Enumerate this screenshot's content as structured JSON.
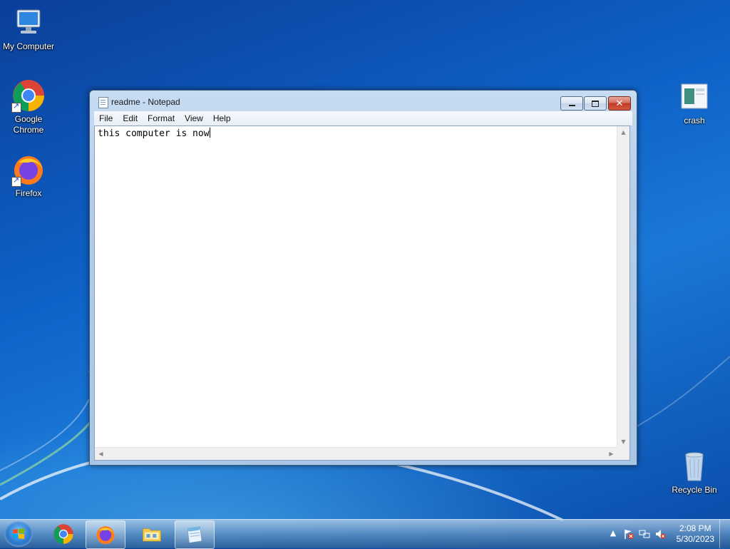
{
  "desktop": {
    "icons": [
      {
        "label": "My Computer",
        "icon": "computer-icon"
      },
      {
        "label": "Google\nChrome",
        "icon": "chrome-icon"
      },
      {
        "label": "Firefox",
        "icon": "firefox-icon"
      },
      {
        "label": "crash",
        "icon": "image-file-icon"
      },
      {
        "label": "Recycle Bin",
        "icon": "recycle-bin-icon"
      }
    ]
  },
  "window": {
    "title": "readme - Notepad",
    "menu": [
      "File",
      "Edit",
      "Format",
      "View",
      "Help"
    ],
    "content": "this computer is now"
  },
  "taskbar": {
    "pinned": [
      "chrome-icon",
      "firefox-icon",
      "explorer-icon",
      "notepad-icon"
    ],
    "active": "firefox-icon",
    "tray_icons": [
      "show-hidden-icons",
      "action-center-icon",
      "network-icon",
      "volume-muted-icon"
    ],
    "time": "2:08 PM",
    "date": "5/30/2023"
  },
  "colors": {
    "accent": "#1a78d6",
    "titlebar": "#b3cde9",
    "close_button": "#c13a23"
  }
}
